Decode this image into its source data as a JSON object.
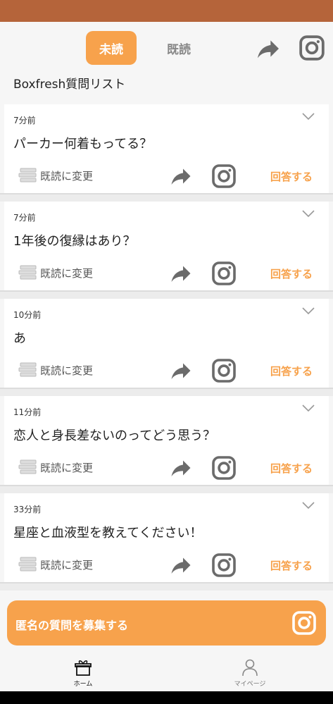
{
  "tabs": {
    "unread_label": "未読",
    "read_label": "既読"
  },
  "header": {
    "list_title": "Boxfresh質問リスト"
  },
  "card_actions": {
    "mark_read_label": "既読に変更",
    "answer_label": "回答する"
  },
  "questions": [
    {
      "time": "7分前",
      "text": "パーカー何着もってる？"
    },
    {
      "time": "7分前",
      "text": "1年後の復縁はあり？"
    },
    {
      "time": "10分前",
      "text": "あ"
    },
    {
      "time": "11分前",
      "text": "恋人と身長差ないのってどう思う？"
    },
    {
      "time": "33分前",
      "text": "星座と血液型を教えてください！"
    }
  ],
  "recruit": {
    "label": "匿名の質問を募集する"
  },
  "bottom_nav": {
    "home_label": "ホーム",
    "mypage_label": "マイページ"
  },
  "colors": {
    "accent": "#f7a24c",
    "status_bar": "#b5643a",
    "icon_gray": "#6b6b6b"
  },
  "icons": [
    "share-arrow-icon",
    "instagram-icon",
    "chevron-down-icon",
    "books-icon",
    "gift-box-icon",
    "person-icon"
  ]
}
